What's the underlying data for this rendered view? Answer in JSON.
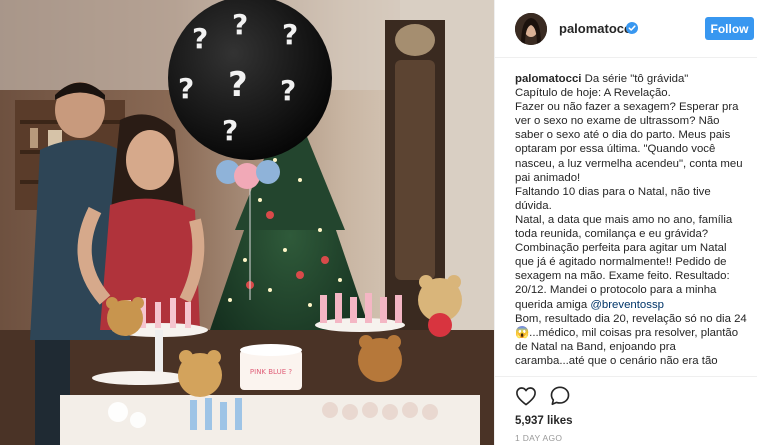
{
  "post": {
    "username": "palomatocci",
    "follow_label": "Follow",
    "caption_user": "palomatocci",
    "caption_body": " Da série \"tô grávida\"\nCapítulo de hoje: A Revelação.\nFazer ou não fazer a sexagem? Esperar pra ver o sexo no exame de ultrassom? Não saber o sexo até o dia do parto. Meus pais optaram por essa última. \"Quando você nasceu, a luz vermelha acendeu\", conta meu pai animado!\nFaltando 10 dias para o Natal, não tive dúvida.\nNatal, a data que mais amo no ano, família toda reunida, comilança e eu grávida? Combinação perfeita para agitar um Natal que já é agitado normalmente!! Pedido de sexagem na mão. Exame feito. Resultado: 20/12. Mandei o protocolo para a minha querida amiga ",
    "caption_mention": "@breventossp",
    "caption_tail": "\nBom, resultado dia 20, revelação só no dia 24 😱...médico, mil coisas pra resolver, plantão de Natal na Band, enjoando pra caramba...até que o cenário não era tão",
    "likes": "5,937 likes",
    "timestamp": "1 DAY AGO",
    "accent_color": "#3897f0",
    "balloon_marks": [
      "?",
      "?",
      "?",
      "?",
      "?",
      "?",
      "?"
    ],
    "cake_text": "PINK BLUE ?"
  }
}
